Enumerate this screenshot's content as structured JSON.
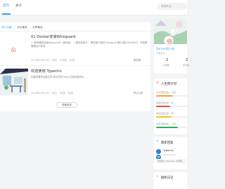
{
  "nav": {
    "items": [
      {
        "label": "首页"
      },
      {
        "label": "关于"
      }
    ],
    "search_placeholder": "搜索关注..."
  },
  "tabs": [
    {
      "label": "热门文章"
    },
    {
      "label": "评论最多"
    },
    {
      "label": "点赞最多"
    }
  ],
  "posts": [
    {
      "title": "01 Docker安装Wireguard",
      "excerpt": "1. 服务器端安装Wireguard一键安装：  一键安装命令：   服务端口释放 Wireguard默认端口为51820，可根据需要自行修改。",
      "meta": "2024年09月14日 · 1评论 · 10阅读 · 0点赞",
      "category": "服务器"
    },
    {
      "title": "欢迎使用 Typecho",
      "excerpt": "如果您看到这篇文章,表示您的 blog 已经安装成功.",
      "meta": "2024年09月14日 · 1评论 · 3阅读 · 0点赞",
      "category": "默认分类"
    }
  ],
  "load_more": "查看更多",
  "profile": {
    "name": "Server的小站",
    "bio": "记录生活",
    "stats": [
      {
        "value": "2",
        "label": "文章数"
      },
      {
        "value": "2",
        "label": "评论数"
      }
    ]
  },
  "life": {
    "title": "人生倒计时",
    "rows": [
      {
        "label": "今日已经过去 ...小时",
        "pct": 0.55,
        "color": "#f5a623"
      },
      {
        "label": "本周已经过去 ...天",
        "pct": 0.45,
        "color": "#e74c3c"
      },
      {
        "label": "本月已经过去 ...天",
        "pct": 0.5,
        "color": "#f1c40f"
      },
      {
        "label": "今年已经过去 ...个月",
        "pct": 0.7,
        "color": "#27ae60"
      }
    ]
  },
  "recent_reply": {
    "title": "最新回复",
    "author": "Typecho",
    "date": "2024-09-14",
    "text": "欢迎加入 Typecho 大家族"
  },
  "random": {
    "title": "随机日记"
  }
}
